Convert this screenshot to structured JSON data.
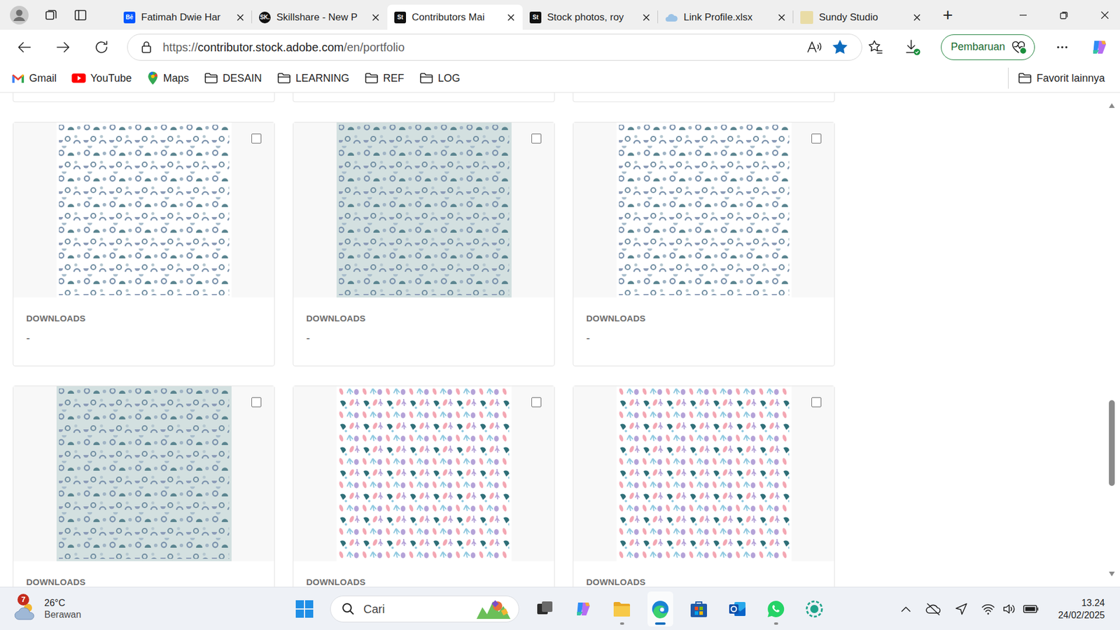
{
  "browser": {
    "tabs": [
      {
        "label": "Fatimah Dwie Har",
        "selected": false,
        "kind": "square",
        "icon": "Bē",
        "color": "#0057ff"
      },
      {
        "label": "Skillshare - New P",
        "selected": false,
        "kind": "circle",
        "icon": "SK.",
        "color": "#111111"
      },
      {
        "label": "Contributors Mai",
        "selected": true,
        "kind": "square",
        "icon": "St",
        "color": "#111111"
      },
      {
        "label": "Stock photos, roy",
        "selected": false,
        "kind": "square",
        "icon": "St",
        "color": "#111111"
      },
      {
        "label": "Link Profile.xlsx",
        "selected": false,
        "kind": "cloud",
        "color": "#9cc3e6"
      },
      {
        "label": "Sundy Studio",
        "selected": false,
        "kind": "swatch",
        "color": "#e9dca6"
      }
    ],
    "new_tab": "+",
    "address": {
      "prefix": "https://",
      "host": "contributor.stock.adobe.com",
      "path": "/en/portfolio",
      "favorite": true
    },
    "update_button": "Pembaruan",
    "bookmarks": [
      {
        "label": "Gmail",
        "kind": "gmail"
      },
      {
        "label": "YouTube",
        "kind": "youtube"
      },
      {
        "label": "Maps",
        "kind": "maps"
      },
      {
        "label": "DESAIN",
        "kind": "folder"
      },
      {
        "label": "LEARNING",
        "kind": "folder"
      },
      {
        "label": "REF",
        "kind": "folder"
      },
      {
        "label": "LOG",
        "kind": "folder"
      }
    ],
    "other_bookmarks": "Favorit lainnya"
  },
  "portfolio": {
    "rows": [
      [
        {
          "kind": "geometric",
          "color": "#ffffff",
          "label": "DOWNLOADS",
          "value": "-",
          "checked": false
        },
        {
          "kind": "geometric",
          "color": "#d3e0e0",
          "label": "DOWNLOADS",
          "value": "-",
          "checked": false
        },
        {
          "kind": "geometric",
          "color": "#ffffff",
          "label": "DOWNLOADS",
          "value": "-",
          "checked": false
        }
      ],
      [
        {
          "kind": "geometric",
          "color": "#d3e0e0",
          "label": "DOWNLOADS",
          "checked": false
        },
        {
          "kind": "botanical",
          "color": "#ffffff",
          "label": "DOWNLOADS",
          "checked": false
        },
        {
          "kind": "botanical",
          "color": "#ffffff",
          "label": "DOWNLOADS",
          "checked": false
        }
      ]
    ],
    "scrollbar": {
      "thumb_start": 0.633,
      "thumb_size": 0.188
    }
  },
  "taskbar": {
    "weather": {
      "temp": "26°C",
      "condition": "Berawan",
      "badge": "7"
    },
    "search": {
      "placeholder": "Cari"
    },
    "apps": [
      {
        "kind": "taskview",
        "indicator": "none"
      },
      {
        "kind": "copilot",
        "indicator": "none"
      },
      {
        "kind": "explorer",
        "indicator": "running"
      },
      {
        "kind": "edge",
        "indicator": "active"
      },
      {
        "kind": "store",
        "indicator": "none"
      },
      {
        "kind": "outlook",
        "indicator": "none"
      },
      {
        "kind": "whatsapp",
        "indicator": "running"
      },
      {
        "kind": "recorder",
        "indicator": "none"
      }
    ],
    "clock": {
      "time": "13.24",
      "date": "24/02/2025"
    }
  }
}
